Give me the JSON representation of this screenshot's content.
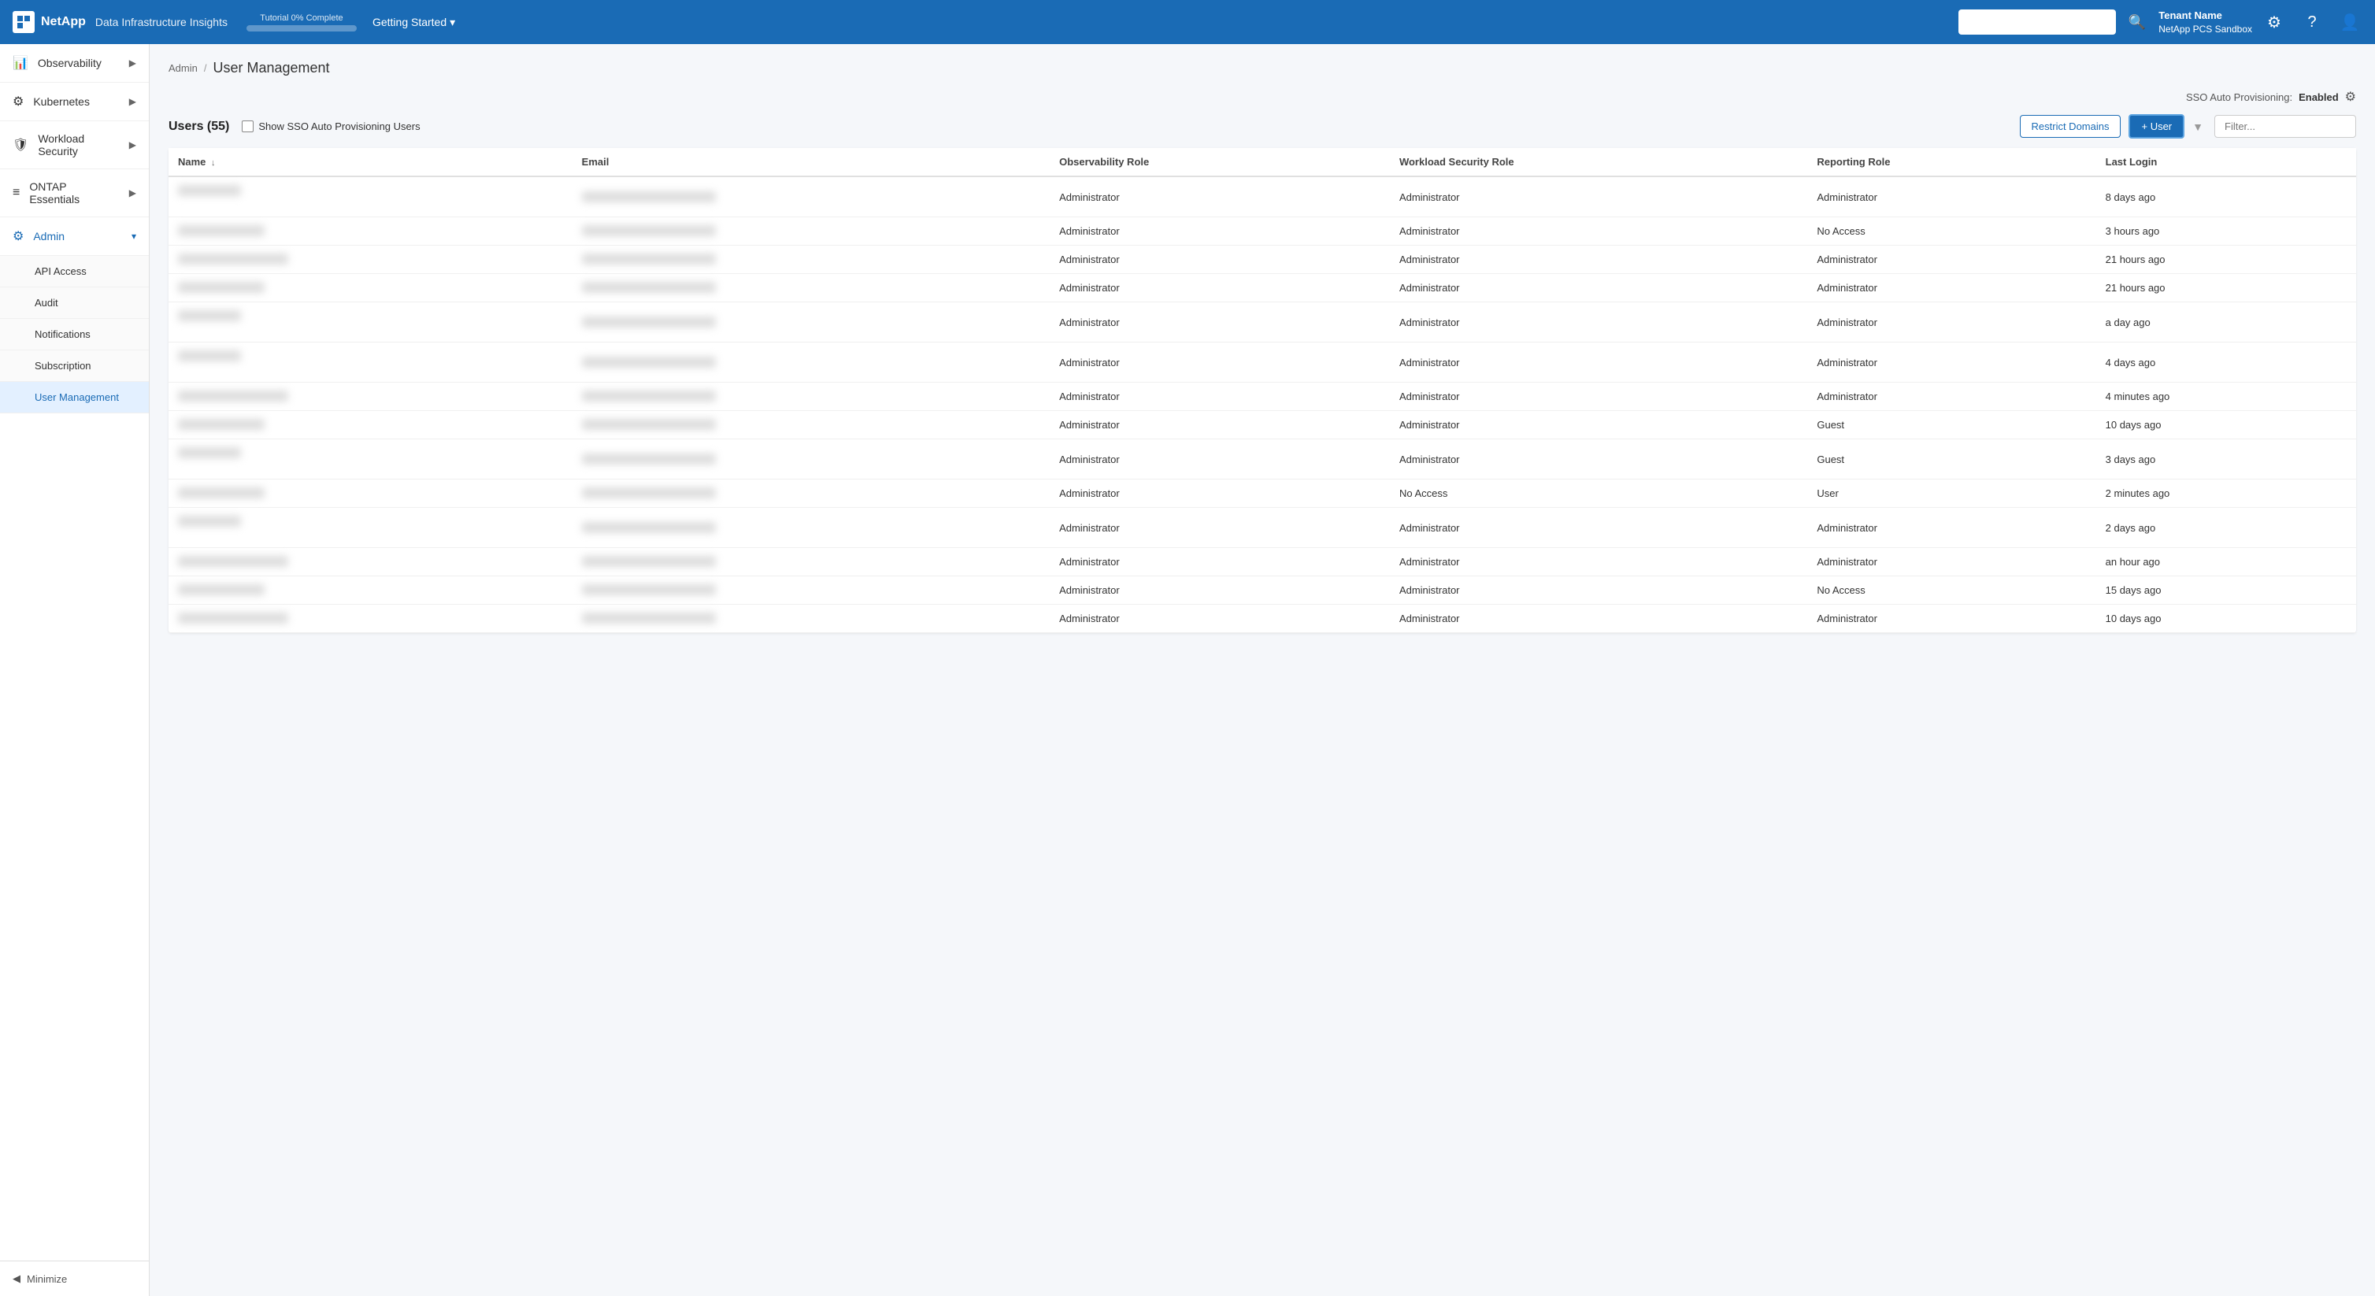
{
  "topNav": {
    "logoText": "NetApp",
    "appName": "Data Infrastructure Insights",
    "tutorial": {
      "label": "Tutorial 0% Complete",
      "percent": 0
    },
    "gettingStarted": "Getting Started",
    "tenantName": "Tenant Name",
    "tenantSub": "NetApp PCS Sandbox"
  },
  "sidebar": {
    "items": [
      {
        "id": "observability",
        "label": "Observability",
        "icon": "📊",
        "hasChevron": true
      },
      {
        "id": "kubernetes",
        "label": "Kubernetes",
        "icon": "⚙",
        "hasChevron": true
      },
      {
        "id": "workload-security",
        "label": "Workload Security",
        "icon": "🛡",
        "hasChevron": true
      },
      {
        "id": "ontap-essentials",
        "label": "ONTAP Essentials",
        "icon": "≡",
        "hasChevron": true
      },
      {
        "id": "admin",
        "label": "Admin",
        "icon": "⚙",
        "hasChevron": false,
        "expanded": true
      }
    ],
    "adminSubItems": [
      {
        "id": "api-access",
        "label": "API Access",
        "active": false
      },
      {
        "id": "audit",
        "label": "Audit",
        "active": false
      },
      {
        "id": "notifications",
        "label": "Notifications",
        "active": false
      },
      {
        "id": "subscription",
        "label": "Subscription",
        "active": false
      },
      {
        "id": "user-management",
        "label": "User Management",
        "active": true
      }
    ],
    "minimizeLabel": "Minimize"
  },
  "breadcrumb": {
    "parent": "Admin",
    "current": "User Management"
  },
  "sso": {
    "label": "SSO Auto Provisioning:",
    "status": "Enabled"
  },
  "usersSection": {
    "countLabel": "Users (55)",
    "showSSOLabel": "Show SSO Auto Provisioning Users",
    "restrictDomainsBtn": "Restrict Domains",
    "addUserBtn": "+ User",
    "filterPlaceholder": "Filter..."
  },
  "table": {
    "columns": [
      {
        "id": "name",
        "label": "Name",
        "sortable": true
      },
      {
        "id": "email",
        "label": "Email",
        "sortable": false
      },
      {
        "id": "observabilityRole",
        "label": "Observability Role",
        "sortable": false
      },
      {
        "id": "workloadSecurityRole",
        "label": "Workload Security Role",
        "sortable": false
      },
      {
        "id": "reportingRole",
        "label": "Reporting Role",
        "sortable": false
      },
      {
        "id": "lastLogin",
        "label": "Last Login",
        "sortable": false
      }
    ],
    "rows": [
      {
        "observabilityRole": "Administrator",
        "workloadSecurityRole": "Administrator",
        "reportingRole": "Administrator",
        "lastLogin": "8 days ago"
      },
      {
        "observabilityRole": "Administrator",
        "workloadSecurityRole": "Administrator",
        "reportingRole": "No Access",
        "lastLogin": "3 hours ago"
      },
      {
        "observabilityRole": "Administrator",
        "workloadSecurityRole": "Administrator",
        "reportingRole": "Administrator",
        "lastLogin": "21 hours ago"
      },
      {
        "observabilityRole": "Administrator",
        "workloadSecurityRole": "Administrator",
        "reportingRole": "Administrator",
        "lastLogin": "21 hours ago"
      },
      {
        "observabilityRole": "Administrator",
        "workloadSecurityRole": "Administrator",
        "reportingRole": "Administrator",
        "lastLogin": "a day ago"
      },
      {
        "observabilityRole": "Administrator",
        "workloadSecurityRole": "Administrator",
        "reportingRole": "Administrator",
        "lastLogin": "4 days ago"
      },
      {
        "observabilityRole": "Administrator",
        "workloadSecurityRole": "Administrator",
        "reportingRole": "Administrator",
        "lastLogin": "4 minutes ago"
      },
      {
        "observabilityRole": "Administrator",
        "workloadSecurityRole": "Administrator",
        "reportingRole": "Guest",
        "lastLogin": "10 days ago"
      },
      {
        "observabilityRole": "Administrator",
        "workloadSecurityRole": "Administrator",
        "reportingRole": "Guest",
        "lastLogin": "3 days ago"
      },
      {
        "observabilityRole": "Administrator",
        "workloadSecurityRole": "No Access",
        "reportingRole": "User",
        "lastLogin": "2 minutes ago"
      },
      {
        "observabilityRole": "Administrator",
        "workloadSecurityRole": "Administrator",
        "reportingRole": "Administrator",
        "lastLogin": "2 days ago"
      },
      {
        "observabilityRole": "Administrator",
        "workloadSecurityRole": "Administrator",
        "reportingRole": "Administrator",
        "lastLogin": "an hour ago"
      },
      {
        "observabilityRole": "Administrator",
        "workloadSecurityRole": "Administrator",
        "reportingRole": "No Access",
        "lastLogin": "15 days ago"
      },
      {
        "observabilityRole": "Administrator",
        "workloadSecurityRole": "Administrator",
        "reportingRole": "Administrator",
        "lastLogin": "10 days ago"
      }
    ]
  }
}
